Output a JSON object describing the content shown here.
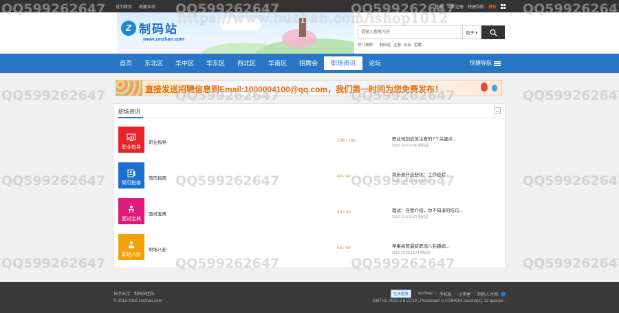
{
  "topbar": {
    "links": [
      "设为首页",
      "收藏本站"
    ],
    "right_links": [
      "登录",
      "立即注册",
      "快捷导航"
    ],
    "accent_link": "模板"
  },
  "watermark": {
    "url": "https://www.huzhan.com/ishop1012",
    "qq": "QQ599262647"
  },
  "logo": {
    "mark": "Z",
    "name": "制码站",
    "url": "www.zmzhan.com"
  },
  "search": {
    "placeholder": "请输入搜索内容",
    "type_label": "帖子",
    "hot_label": "热门搜索：",
    "hot_words": [
      "制码站",
      "注册",
      "论坛",
      "招聘"
    ]
  },
  "nav": {
    "items": [
      "首页",
      "东北区",
      "华中区",
      "华东区",
      "西北区",
      "华南区",
      "招聘会",
      "职场资讯",
      "论坛"
    ],
    "active_index": 7,
    "quick": "快捷导航"
  },
  "ad": {
    "text": "直接发送招聘信息到Email:1000004100@qq.com，我们第一时间为您免费发布！"
  },
  "panel": {
    "title": "职场资讯",
    "forums": [
      {
        "icon_label": "职业指导",
        "name": "职业指导",
        "count": "198 / 198",
        "last_title": "职业规划应该注意的7个关键点...",
        "last_meta": "2016-10-3 22:40 制码站",
        "color": "#e5252a"
      },
      {
        "icon_label": "简历指南",
        "name": "简历指南",
        "count": "40 / 40",
        "last_title": "简历避开这些坑：工作经验...",
        "last_meta": "2016-10-8 10:22 制码站",
        "color": "#1b6fd0"
      },
      {
        "icon_label": "面试宝典",
        "name": "面试宝典",
        "count": "40 / 40",
        "last_title": "面试：自我介绍，你不知道的技巧...",
        "last_meta": "2016-12-8 10:21 制码站",
        "color": "#e0197d"
      },
      {
        "icon_label": "职场八卦",
        "name": "职场八卦",
        "count": "68 / 68",
        "last_title": "苹果高管最新职场八卦趣闻...",
        "last_meta": "2016-10-28 13:24 制码站",
        "color": "#f4a20c"
      }
    ]
  },
  "footer": {
    "support": "技术支持：制码站团队",
    "copyright": "© 2015-2016 zmzhan.com",
    "online": "在线客服",
    "links": [
      "Archiver",
      "手机版",
      "小黑屋",
      "制码人才网"
    ],
    "stats": "GMT+8, 2020-3-6 22:19 , Processed in 0.064004 second(s), 12 queries ."
  }
}
